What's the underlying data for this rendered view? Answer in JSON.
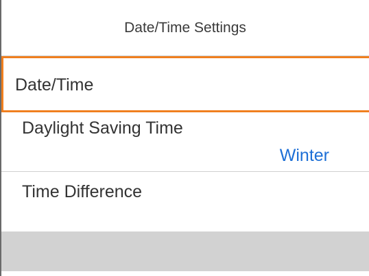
{
  "header": {
    "title": "Date/Time Settings"
  },
  "menu": {
    "items": [
      {
        "label": "Date/Time",
        "selected": true
      },
      {
        "label": "Daylight Saving Time",
        "value": "Winter"
      },
      {
        "label": "Time Difference"
      }
    ]
  },
  "colors": {
    "selection_border": "#f07f1f",
    "value_text": "#1d6fd6",
    "footer_bar": "#d2d2d2",
    "divider": "#cfcfcf"
  }
}
